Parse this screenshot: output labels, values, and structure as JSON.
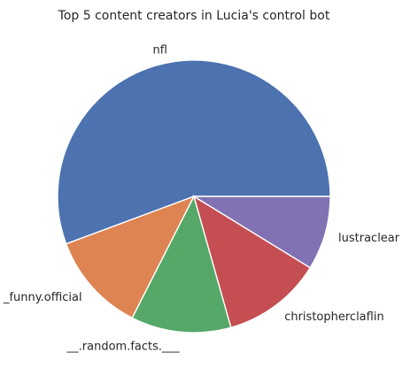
{
  "chart_data": {
    "type": "pie",
    "title": "Top 5 content creators in Lucia's control bot",
    "start_angle_deg": 0,
    "direction": "counterclockwise",
    "slices": [
      {
        "label": "nfl",
        "value": 54,
        "color": "#4c72b0"
      },
      {
        "label": "_funny.official",
        "value": 11.5,
        "color": "#dd8452"
      },
      {
        "label": "__.random.facts.___",
        "value": 11.5,
        "color": "#55a868"
      },
      {
        "label": "christopherclaflin",
        "value": 11.5,
        "color": "#c44e52"
      },
      {
        "label": "lustraclear",
        "value": 8.5,
        "color": "#8172b3"
      }
    ]
  }
}
